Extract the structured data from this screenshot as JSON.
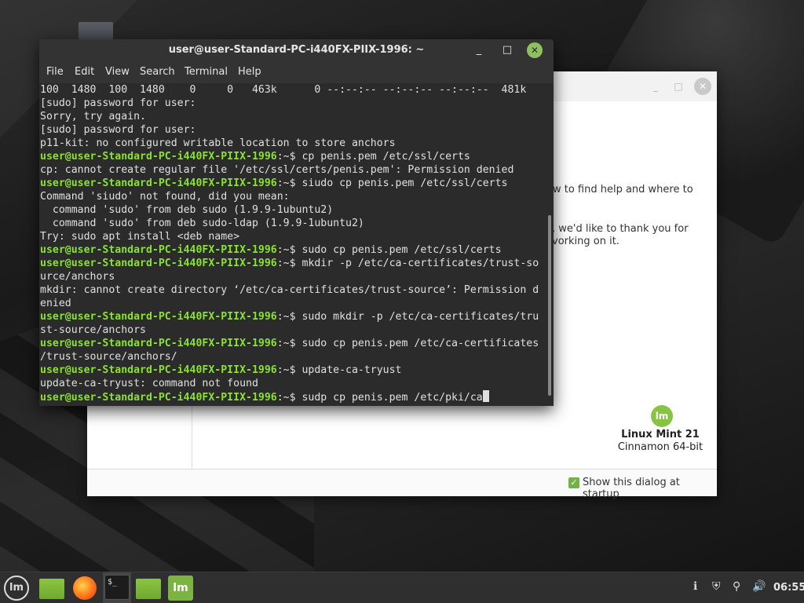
{
  "welcome": {
    "text_line1": "ow to find help and where to",
    "text_line2": ", we'd like to thank you for",
    "text_line3": "vorking on it.",
    "logo_text": "lm",
    "os_name": "Linux Mint 21",
    "os_edition": "Cinnamon 64-bit",
    "show_startup_checked": true,
    "show_startup_label": "Show this dialog at startup",
    "minimize_glyph": "_",
    "maximize_glyph": "□",
    "close_glyph": "✕"
  },
  "terminal": {
    "title": "user@user-Standard-PC-i440FX-PIIX-1996: ~",
    "menu": [
      "File",
      "Edit",
      "View",
      "Search",
      "Terminal",
      "Help"
    ],
    "minimize_glyph": "_",
    "maximize_glyph": "□",
    "close_glyph": "✕",
    "lines": [
      {
        "prompt": "",
        "text": "100  1480  100  1480    0     0   463k      0 --:--:-- --:--:-- --:--:--  481k"
      },
      {
        "prompt": "",
        "text": "[sudo] password for user:"
      },
      {
        "prompt": "",
        "text": "Sorry, try again."
      },
      {
        "prompt": "",
        "text": "[sudo] password for user:"
      },
      {
        "prompt": "",
        "text": "p11-kit: no configured writable location to store anchors"
      },
      {
        "prompt": "user@user-Standard-PC-i440FX-PIIX-1996",
        "text": ":~$ cp penis.pem /etc/ssl/certs"
      },
      {
        "prompt": "",
        "text": "cp: cannot create regular file '/etc/ssl/certs/penis.pem': Permission denied"
      },
      {
        "prompt": "user@user-Standard-PC-i440FX-PIIX-1996",
        "text": ":~$ siudo cp penis.pem /etc/ssl/certs"
      },
      {
        "prompt": "",
        "text": "Command 'siudo' not found, did you mean:"
      },
      {
        "prompt": "",
        "text": "  command 'sudo' from deb sudo (1.9.9-1ubuntu2)"
      },
      {
        "prompt": "",
        "text": "  command 'sudo' from deb sudo-ldap (1.9.9-1ubuntu2)"
      },
      {
        "prompt": "",
        "text": "Try: sudo apt install <deb name>"
      },
      {
        "prompt": "user@user-Standard-PC-i440FX-PIIX-1996",
        "text": ":~$ sudo cp penis.pem /etc/ssl/certs"
      },
      {
        "prompt": "user@user-Standard-PC-i440FX-PIIX-1996",
        "text": ":~$ mkdir -p /etc/ca-certificates/trust-so"
      },
      {
        "prompt": "",
        "text": "urce/anchors"
      },
      {
        "prompt": "",
        "text": "mkdir: cannot create directory ‘/etc/ca-certificates/trust-source’: Permission d"
      },
      {
        "prompt": "",
        "text": "enied"
      },
      {
        "prompt": "user@user-Standard-PC-i440FX-PIIX-1996",
        "text": ":~$ sudo mkdir -p /etc/ca-certificates/tru"
      },
      {
        "prompt": "",
        "text": "st-source/anchors"
      },
      {
        "prompt": "user@user-Standard-PC-i440FX-PIIX-1996",
        "text": ":~$ sudo cp penis.pem /etc/ca-certificates"
      },
      {
        "prompt": "",
        "text": "/trust-source/anchors/"
      },
      {
        "prompt": "user@user-Standard-PC-i440FX-PIIX-1996",
        "text": ":~$ update-ca-tryust"
      },
      {
        "prompt": "",
        "text": "update-ca-tryust: command not found"
      },
      {
        "prompt": "user@user-Standard-PC-i440FX-PIIX-1996",
        "text": ":~$ sudp cp penis.pem /etc/pki/ca",
        "cursor": true
      }
    ]
  },
  "taskbar": {
    "menu_logo": "lm",
    "terminal_icon_text": "$_",
    "mint_welcome_logo": "lm",
    "tray_info": "ℹ",
    "tray_shield": "⛨",
    "tray_network": "⚲",
    "tray_volume": "🔊",
    "clock": "06:55"
  },
  "colors": {
    "prompt": "#8ae234",
    "terminal_bg": "#2b2b2b",
    "mint_green": "#87c444"
  }
}
